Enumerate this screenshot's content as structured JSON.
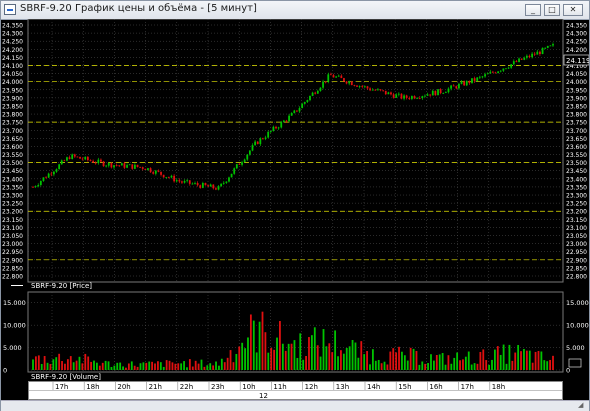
{
  "window": {
    "title": "SBRF-9.20 График цены и объёма - [5 минут]",
    "buttons": {
      "minimize": "_",
      "maximize": "□",
      "close": "✕"
    }
  },
  "price_panel": {
    "legend_label": "SBRF-9.20 [Price]",
    "current_price_label": "24.119",
    "y_tick_labels": [
      "24.350",
      "24.300",
      "24.250",
      "24.200",
      "24.150",
      "24.100",
      "24.050",
      "24.000",
      "23.950",
      "23.900",
      "23.850",
      "23.800",
      "23.750",
      "23.700",
      "23.650",
      "23.600",
      "23.550",
      "23.500",
      "23.450",
      "23.400",
      "23.350",
      "23.300",
      "23.250",
      "23.200",
      "23.150",
      "23.100",
      "23.050",
      "23.000",
      "22.950",
      "22.900",
      "22.850",
      "22.800"
    ],
    "level_lines": [
      24.1,
      24.0,
      23.75,
      23.5,
      23.2,
      22.9
    ]
  },
  "volume_panel": {
    "legend_label": "SBRF-9.20 [Volume]",
    "y_tick_labels": [
      "15.000",
      "10.000",
      "5.000",
      "0"
    ]
  },
  "x_axis": {
    "hour_labels": [
      "17h",
      "18h",
      "20h",
      "21h",
      "22h",
      "23h",
      "10h",
      "11h",
      "12h",
      "13h",
      "14h",
      "15h",
      "16h",
      "17h",
      "18h"
    ],
    "day_label": "12"
  },
  "chart_data": [
    {
      "type": "line",
      "title": "SBRF-9.20 [Price]",
      "series": [
        {
          "name": "SBRF-9.20 [Price]",
          "x": [
            "17h",
            "18h",
            "20h",
            "21h",
            "22h",
            "23h",
            "10h",
            "11h",
            "12h",
            "13h",
            "14h",
            "15h",
            "16h",
            "17h",
            "18h"
          ],
          "values": [
            23.35,
            23.54,
            23.49,
            23.47,
            23.38,
            23.34,
            23.62,
            23.8,
            24.04,
            23.96,
            23.9,
            23.94,
            24.02,
            24.12,
            24.22
          ]
        }
      ],
      "last_value": 24.119,
      "ylim": [
        22.8,
        24.35
      ],
      "grid": true,
      "colors": {
        "up": "#00c400",
        "down": "#e01010",
        "level": "#e8e800",
        "grid": "#555555"
      }
    },
    {
      "type": "bar",
      "title": "SBRF-9.20 [Volume]",
      "x": [
        "17h",
        "18h",
        "20h",
        "21h",
        "22h",
        "23h",
        "10h",
        "11h",
        "12h",
        "13h",
        "14h",
        "15h",
        "16h",
        "17h",
        "18h"
      ],
      "series": [
        {
          "name": "SBRF-9.20 [Volume]",
          "values": [
            3500,
            4000,
            2000,
            1800,
            2200,
            2000,
            13000,
            8000,
            9000,
            5000,
            4500,
            3500,
            4000,
            5500,
            3000
          ]
        }
      ],
      "ylim": [
        0,
        16500
      ]
    }
  ]
}
